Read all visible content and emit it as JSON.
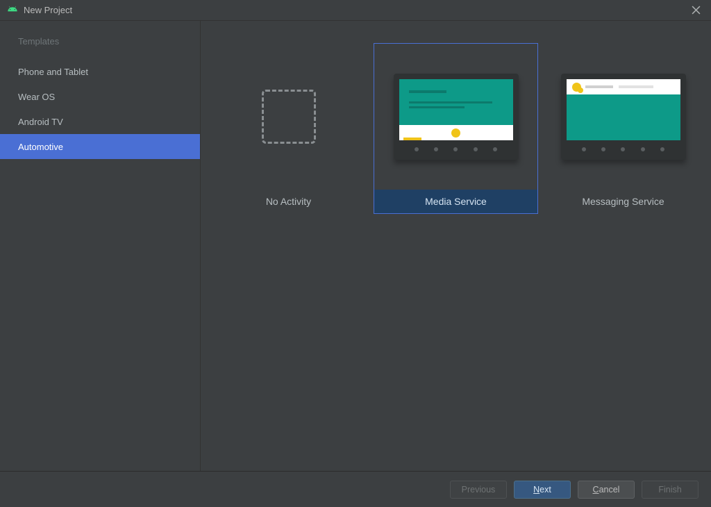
{
  "window": {
    "title": "New Project"
  },
  "sidebar": {
    "header": "Templates",
    "items": [
      {
        "label": "Phone and Tablet"
      },
      {
        "label": "Wear OS"
      },
      {
        "label": "Android TV"
      },
      {
        "label": "Automotive"
      }
    ],
    "selected_index": 3
  },
  "templates": [
    {
      "label": "No Activity",
      "kind": "none"
    },
    {
      "label": "Media Service",
      "kind": "media"
    },
    {
      "label": "Messaging Service",
      "kind": "messaging"
    }
  ],
  "selected_template_index": 1,
  "footer": {
    "previous": "Previous",
    "next_prefix": "N",
    "next_rest": "ext",
    "cancel_prefix": "C",
    "cancel_rest": "ancel",
    "finish": "Finish"
  }
}
